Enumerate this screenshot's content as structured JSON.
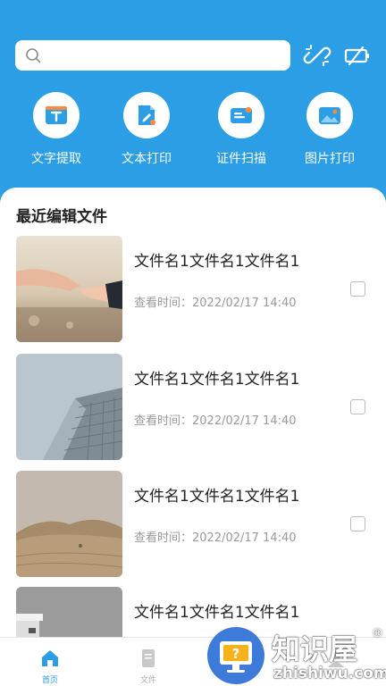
{
  "search": {
    "placeholder": ""
  },
  "toolbar": {
    "unlink_icon": "unlink-icon",
    "battery_icon": "battery-off-icon"
  },
  "functions": [
    {
      "label": "文字提取",
      "icon": "text-extract-icon"
    },
    {
      "label": "文本打印",
      "icon": "document-print-icon"
    },
    {
      "label": "证件扫描",
      "icon": "id-card-icon"
    },
    {
      "label": "图片打印",
      "icon": "image-icon"
    }
  ],
  "recent": {
    "title": "最近编辑文件",
    "items": [
      {
        "name": "文件名1文件名1文件名1",
        "time": "查看时间：2022/02/17  14:40",
        "thumb": "hands-photo"
      },
      {
        "name": "文件名1文件名1文件名1",
        "time": "查看时间：2022/02/17  14:40",
        "thumb": "building-photo"
      },
      {
        "name": "文件名1文件名1文件名1",
        "time": "查看时间：2022/02/17  14:40",
        "thumb": "desert-photo"
      },
      {
        "name": "文件名1文件名1文件名1",
        "time": "",
        "thumb": "grey-building-photo"
      }
    ]
  },
  "nav": {
    "home": "首页",
    "files": "文件"
  },
  "watermark": {
    "brand": "知识屋",
    "domain": "zhishiwu.com",
    "registered": "®"
  },
  "colors": {
    "primary": "#2c9ee5",
    "accent_orange": "#ff8a3d",
    "text_dark": "#222222",
    "text_muted": "#9a9a9a"
  }
}
